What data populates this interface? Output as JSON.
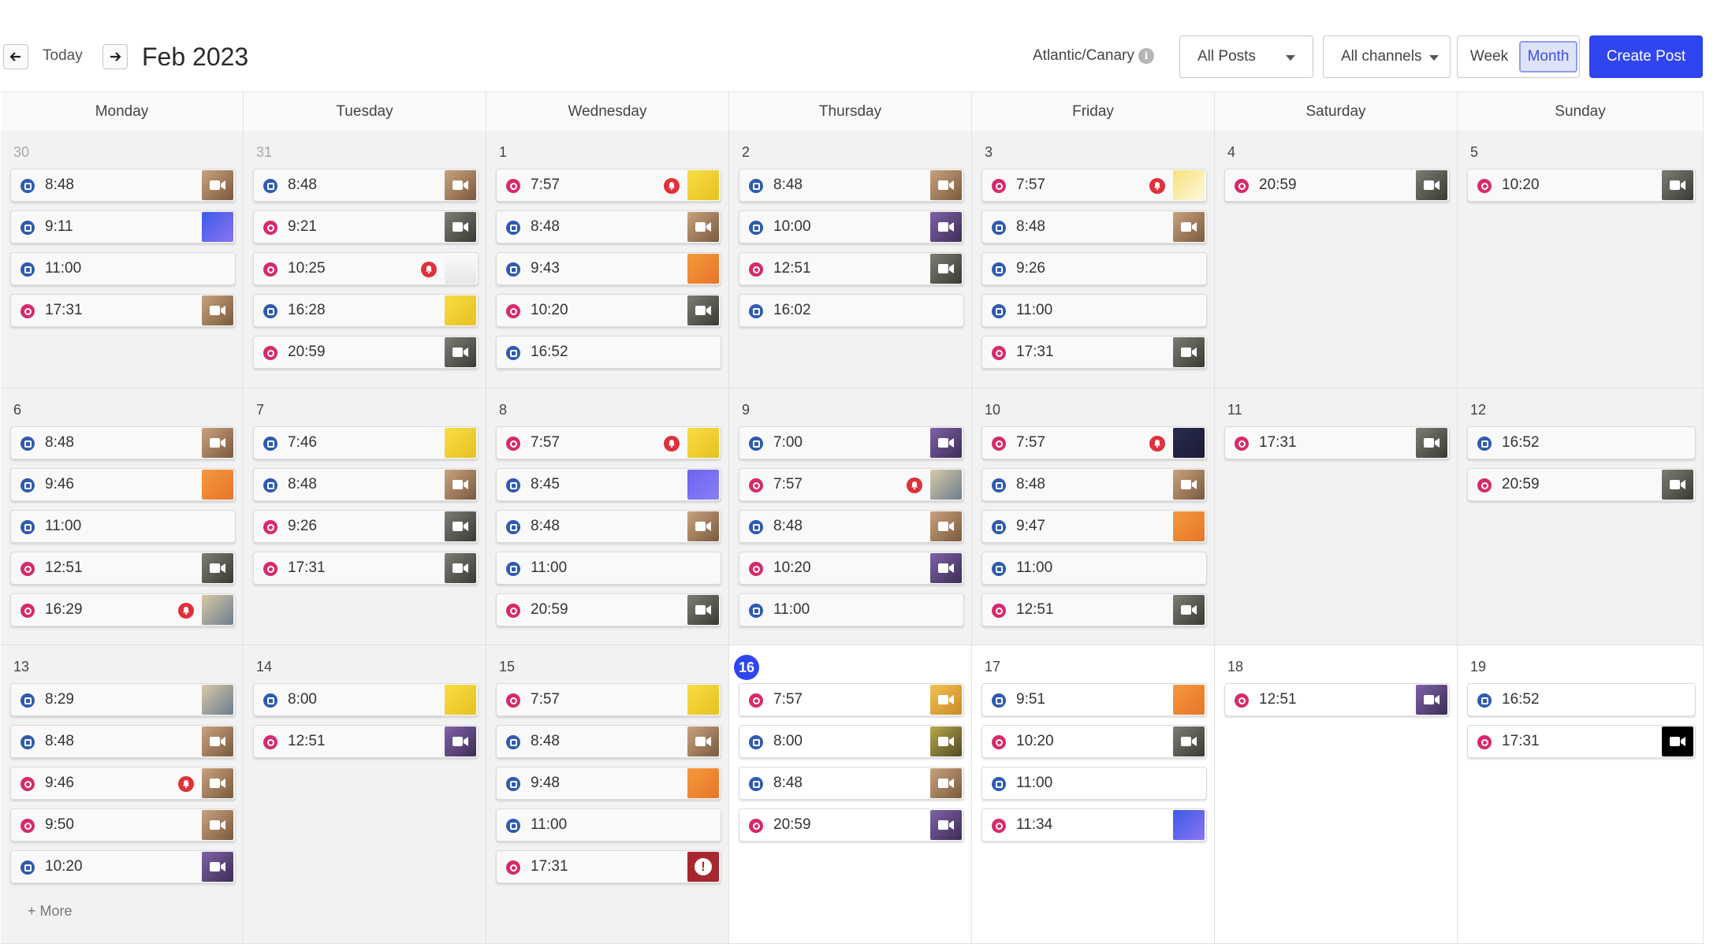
{
  "toolbar": {
    "prev_label": "",
    "today_label": "Today",
    "month_title": "Feb 2023",
    "timezone": "Atlantic/Canary",
    "filter_posts": "All Posts",
    "filter_channels": "All channels",
    "view_week": "Week",
    "view_month": "Month",
    "create_post": "Create Post"
  },
  "weekdays": [
    "Monday",
    "Tuesday",
    "Wednesday",
    "Thursday",
    "Friday",
    "Saturday",
    "Sunday"
  ],
  "colors": {
    "accent": "#2f45f0",
    "linkedin": "#2f5bb0",
    "instagram": "#d62a6c",
    "alert": "#e0303a",
    "past_bg": "#f2f2f2"
  },
  "more_label": "+ More",
  "weeks": [
    [
      {
        "day": "30",
        "muted": true,
        "posts": [
          {
            "time": "8:48",
            "network": "linkedin",
            "thumb": "person"
          },
          {
            "time": "9:11",
            "network": "linkedin",
            "thumb": "graphic-blue"
          },
          {
            "time": "11:00",
            "network": "linkedin",
            "thumb": "none"
          },
          {
            "time": "17:31",
            "network": "instagram",
            "thumb": "person"
          }
        ]
      },
      {
        "day": "31",
        "muted": true,
        "posts": [
          {
            "time": "8:48",
            "network": "linkedin",
            "thumb": "person"
          },
          {
            "time": "9:21",
            "network": "instagram",
            "thumb": "person-dark"
          },
          {
            "time": "10:25",
            "network": "instagram",
            "thumb": "doc",
            "alert": true
          },
          {
            "time": "16:28",
            "network": "linkedin",
            "thumb": "graphic-yellow"
          },
          {
            "time": "20:59",
            "network": "instagram",
            "thumb": "person-dark"
          }
        ]
      },
      {
        "day": "1",
        "posts": [
          {
            "time": "7:57",
            "network": "instagram",
            "thumb": "graphic-yellow",
            "alert": true
          },
          {
            "time": "8:48",
            "network": "linkedin",
            "thumb": "person"
          },
          {
            "time": "9:43",
            "network": "linkedin",
            "thumb": "graphic-orange"
          },
          {
            "time": "10:20",
            "network": "instagram",
            "thumb": "person-dark"
          },
          {
            "time": "16:52",
            "network": "linkedin",
            "thumb": "none"
          }
        ]
      },
      {
        "day": "2",
        "posts": [
          {
            "time": "8:48",
            "network": "linkedin",
            "thumb": "person"
          },
          {
            "time": "10:00",
            "network": "linkedin",
            "thumb": "person-purple"
          },
          {
            "time": "12:51",
            "network": "instagram",
            "thumb": "person-dark"
          },
          {
            "time": "16:02",
            "network": "linkedin",
            "thumb": "none"
          }
        ]
      },
      {
        "day": "3",
        "posts": [
          {
            "time": "7:57",
            "network": "instagram",
            "thumb": "doc-yellow",
            "alert": true
          },
          {
            "time": "8:48",
            "network": "linkedin",
            "thumb": "person"
          },
          {
            "time": "9:26",
            "network": "linkedin",
            "thumb": "none"
          },
          {
            "time": "11:00",
            "network": "linkedin",
            "thumb": "none"
          },
          {
            "time": "17:31",
            "network": "instagram",
            "thumb": "person-dark"
          }
        ]
      },
      {
        "day": "4",
        "posts": [
          {
            "time": "20:59",
            "network": "instagram",
            "thumb": "person-dark"
          }
        ]
      },
      {
        "day": "5",
        "posts": [
          {
            "time": "10:20",
            "network": "instagram",
            "thumb": "person-dark"
          }
        ]
      }
    ],
    [
      {
        "day": "6",
        "posts": [
          {
            "time": "8:48",
            "network": "linkedin",
            "thumb": "person"
          },
          {
            "time": "9:46",
            "network": "linkedin",
            "thumb": "graphic-orange"
          },
          {
            "time": "11:00",
            "network": "linkedin",
            "thumb": "none"
          },
          {
            "time": "12:51",
            "network": "instagram",
            "thumb": "person-dark"
          },
          {
            "time": "16:29",
            "network": "instagram",
            "thumb": "photo",
            "alert": true
          }
        ]
      },
      {
        "day": "7",
        "posts": [
          {
            "time": "7:46",
            "network": "linkedin",
            "thumb": "graphic-yellow"
          },
          {
            "time": "8:48",
            "network": "linkedin",
            "thumb": "person"
          },
          {
            "time": "9:26",
            "network": "instagram",
            "thumb": "person-dark"
          },
          {
            "time": "17:31",
            "network": "instagram",
            "thumb": "person-dark"
          }
        ]
      },
      {
        "day": "8",
        "posts": [
          {
            "time": "7:57",
            "network": "instagram",
            "thumb": "graphic-yellow",
            "alert": true
          },
          {
            "time": "8:45",
            "network": "linkedin",
            "thumb": "graphic-violet"
          },
          {
            "time": "8:48",
            "network": "linkedin",
            "thumb": "person"
          },
          {
            "time": "11:00",
            "network": "linkedin",
            "thumb": "none"
          },
          {
            "time": "20:59",
            "network": "instagram",
            "thumb": "person-dark"
          }
        ]
      },
      {
        "day": "9",
        "posts": [
          {
            "time": "7:00",
            "network": "linkedin",
            "thumb": "person-purple"
          },
          {
            "time": "7:57",
            "network": "instagram",
            "thumb": "photo",
            "alert": true
          },
          {
            "time": "8:48",
            "network": "linkedin",
            "thumb": "person"
          },
          {
            "time": "10:20",
            "network": "instagram",
            "thumb": "person-purple"
          },
          {
            "time": "11:00",
            "network": "linkedin",
            "thumb": "none"
          }
        ]
      },
      {
        "day": "10",
        "posts": [
          {
            "time": "7:57",
            "network": "instagram",
            "thumb": "graphic-navy",
            "alert": true
          },
          {
            "time": "8:48",
            "network": "linkedin",
            "thumb": "person"
          },
          {
            "time": "9:47",
            "network": "linkedin",
            "thumb": "graphic-orange"
          },
          {
            "time": "11:00",
            "network": "linkedin",
            "thumb": "none"
          },
          {
            "time": "12:51",
            "network": "instagram",
            "thumb": "person-dark"
          }
        ]
      },
      {
        "day": "11",
        "posts": [
          {
            "time": "17:31",
            "network": "instagram",
            "thumb": "person-dark"
          }
        ]
      },
      {
        "day": "12",
        "posts": [
          {
            "time": "16:52",
            "network": "linkedin",
            "thumb": "none"
          },
          {
            "time": "20:59",
            "network": "instagram",
            "thumb": "person-dark"
          }
        ]
      }
    ],
    [
      {
        "day": "13",
        "more": true,
        "posts": [
          {
            "time": "8:29",
            "network": "linkedin",
            "thumb": "photo"
          },
          {
            "time": "8:48",
            "network": "linkedin",
            "thumb": "person"
          },
          {
            "time": "9:46",
            "network": "instagram",
            "thumb": "person",
            "alert": true
          },
          {
            "time": "9:50",
            "network": "instagram",
            "thumb": "person"
          },
          {
            "time": "10:20",
            "network": "linkedin",
            "thumb": "person-purple"
          }
        ]
      },
      {
        "day": "14",
        "posts": [
          {
            "time": "8:00",
            "network": "linkedin",
            "thumb": "graphic-yellow"
          },
          {
            "time": "12:51",
            "network": "instagram",
            "thumb": "person-purple"
          }
        ]
      },
      {
        "day": "15",
        "posts": [
          {
            "time": "7:57",
            "network": "instagram",
            "thumb": "graphic-yellow"
          },
          {
            "time": "8:48",
            "network": "linkedin",
            "thumb": "person"
          },
          {
            "time": "9:48",
            "network": "linkedin",
            "thumb": "graphic-orange"
          },
          {
            "time": "11:00",
            "network": "linkedin",
            "thumb": "none"
          },
          {
            "time": "17:31",
            "network": "instagram",
            "thumb": "error"
          }
        ]
      },
      {
        "day": "16",
        "today": true,
        "future": true,
        "posts": [
          {
            "time": "7:57",
            "network": "instagram",
            "thumb": "person-yellow"
          },
          {
            "time": "8:00",
            "network": "linkedin",
            "thumb": "person-olive"
          },
          {
            "time": "8:48",
            "network": "linkedin",
            "thumb": "person"
          },
          {
            "time": "20:59",
            "network": "instagram",
            "thumb": "person-purple"
          }
        ]
      },
      {
        "day": "17",
        "future": true,
        "posts": [
          {
            "time": "9:51",
            "network": "linkedin",
            "thumb": "graphic-orange"
          },
          {
            "time": "10:20",
            "network": "instagram",
            "thumb": "person-dark"
          },
          {
            "time": "11:00",
            "network": "linkedin",
            "thumb": "none"
          },
          {
            "time": "11:34",
            "network": "instagram",
            "thumb": "graphic-blue"
          }
        ]
      },
      {
        "day": "18",
        "future": true,
        "posts": [
          {
            "time": "12:51",
            "network": "instagram",
            "thumb": "person-purple"
          }
        ]
      },
      {
        "day": "19",
        "future": true,
        "posts": [
          {
            "time": "16:52",
            "network": "linkedin",
            "thumb": "none"
          },
          {
            "time": "17:31",
            "network": "instagram",
            "thumb": "black"
          }
        ]
      }
    ]
  ]
}
